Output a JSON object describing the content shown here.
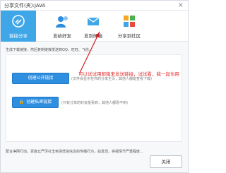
{
  "window": {
    "title": "分享文件(夹):JAVA",
    "close_glyph": "×"
  },
  "tabs": [
    {
      "label": "链接分享",
      "icon": "link-share-icon",
      "active": true
    },
    {
      "label": "发给好友",
      "icon": "friend-icon",
      "active": false
    },
    {
      "label": "发到邮箱",
      "icon": "mail-icon",
      "active": false
    },
    {
      "label": "分享到社区",
      "icon": "community-icon",
      "active": false
    }
  ],
  "description": "生成下载链接，然后复制链接发送到QQ、旺旺、飞信…",
  "public_link": {
    "button_label": "创建公开链接",
    "hint": "(文件会显示在你的分享主页，其他人都能查看下载)"
  },
  "private_link": {
    "button_label": "创建私密链接",
    "hint": "(只有分享的好友能看到，其他人都看不到)"
  },
  "annotation": {
    "text": "可以试试用邮箱来发送链接，试试看，我一起也用",
    "color": "#e03030"
  },
  "footer_note": "配合净网行动，百度云严厉打击色情低俗信息的传播行为，如发现，将视情节严重程度…",
  "close_button_label": "关闭",
  "colors": {
    "accent": "#3fa6e8",
    "button": "#2e8ee0"
  }
}
